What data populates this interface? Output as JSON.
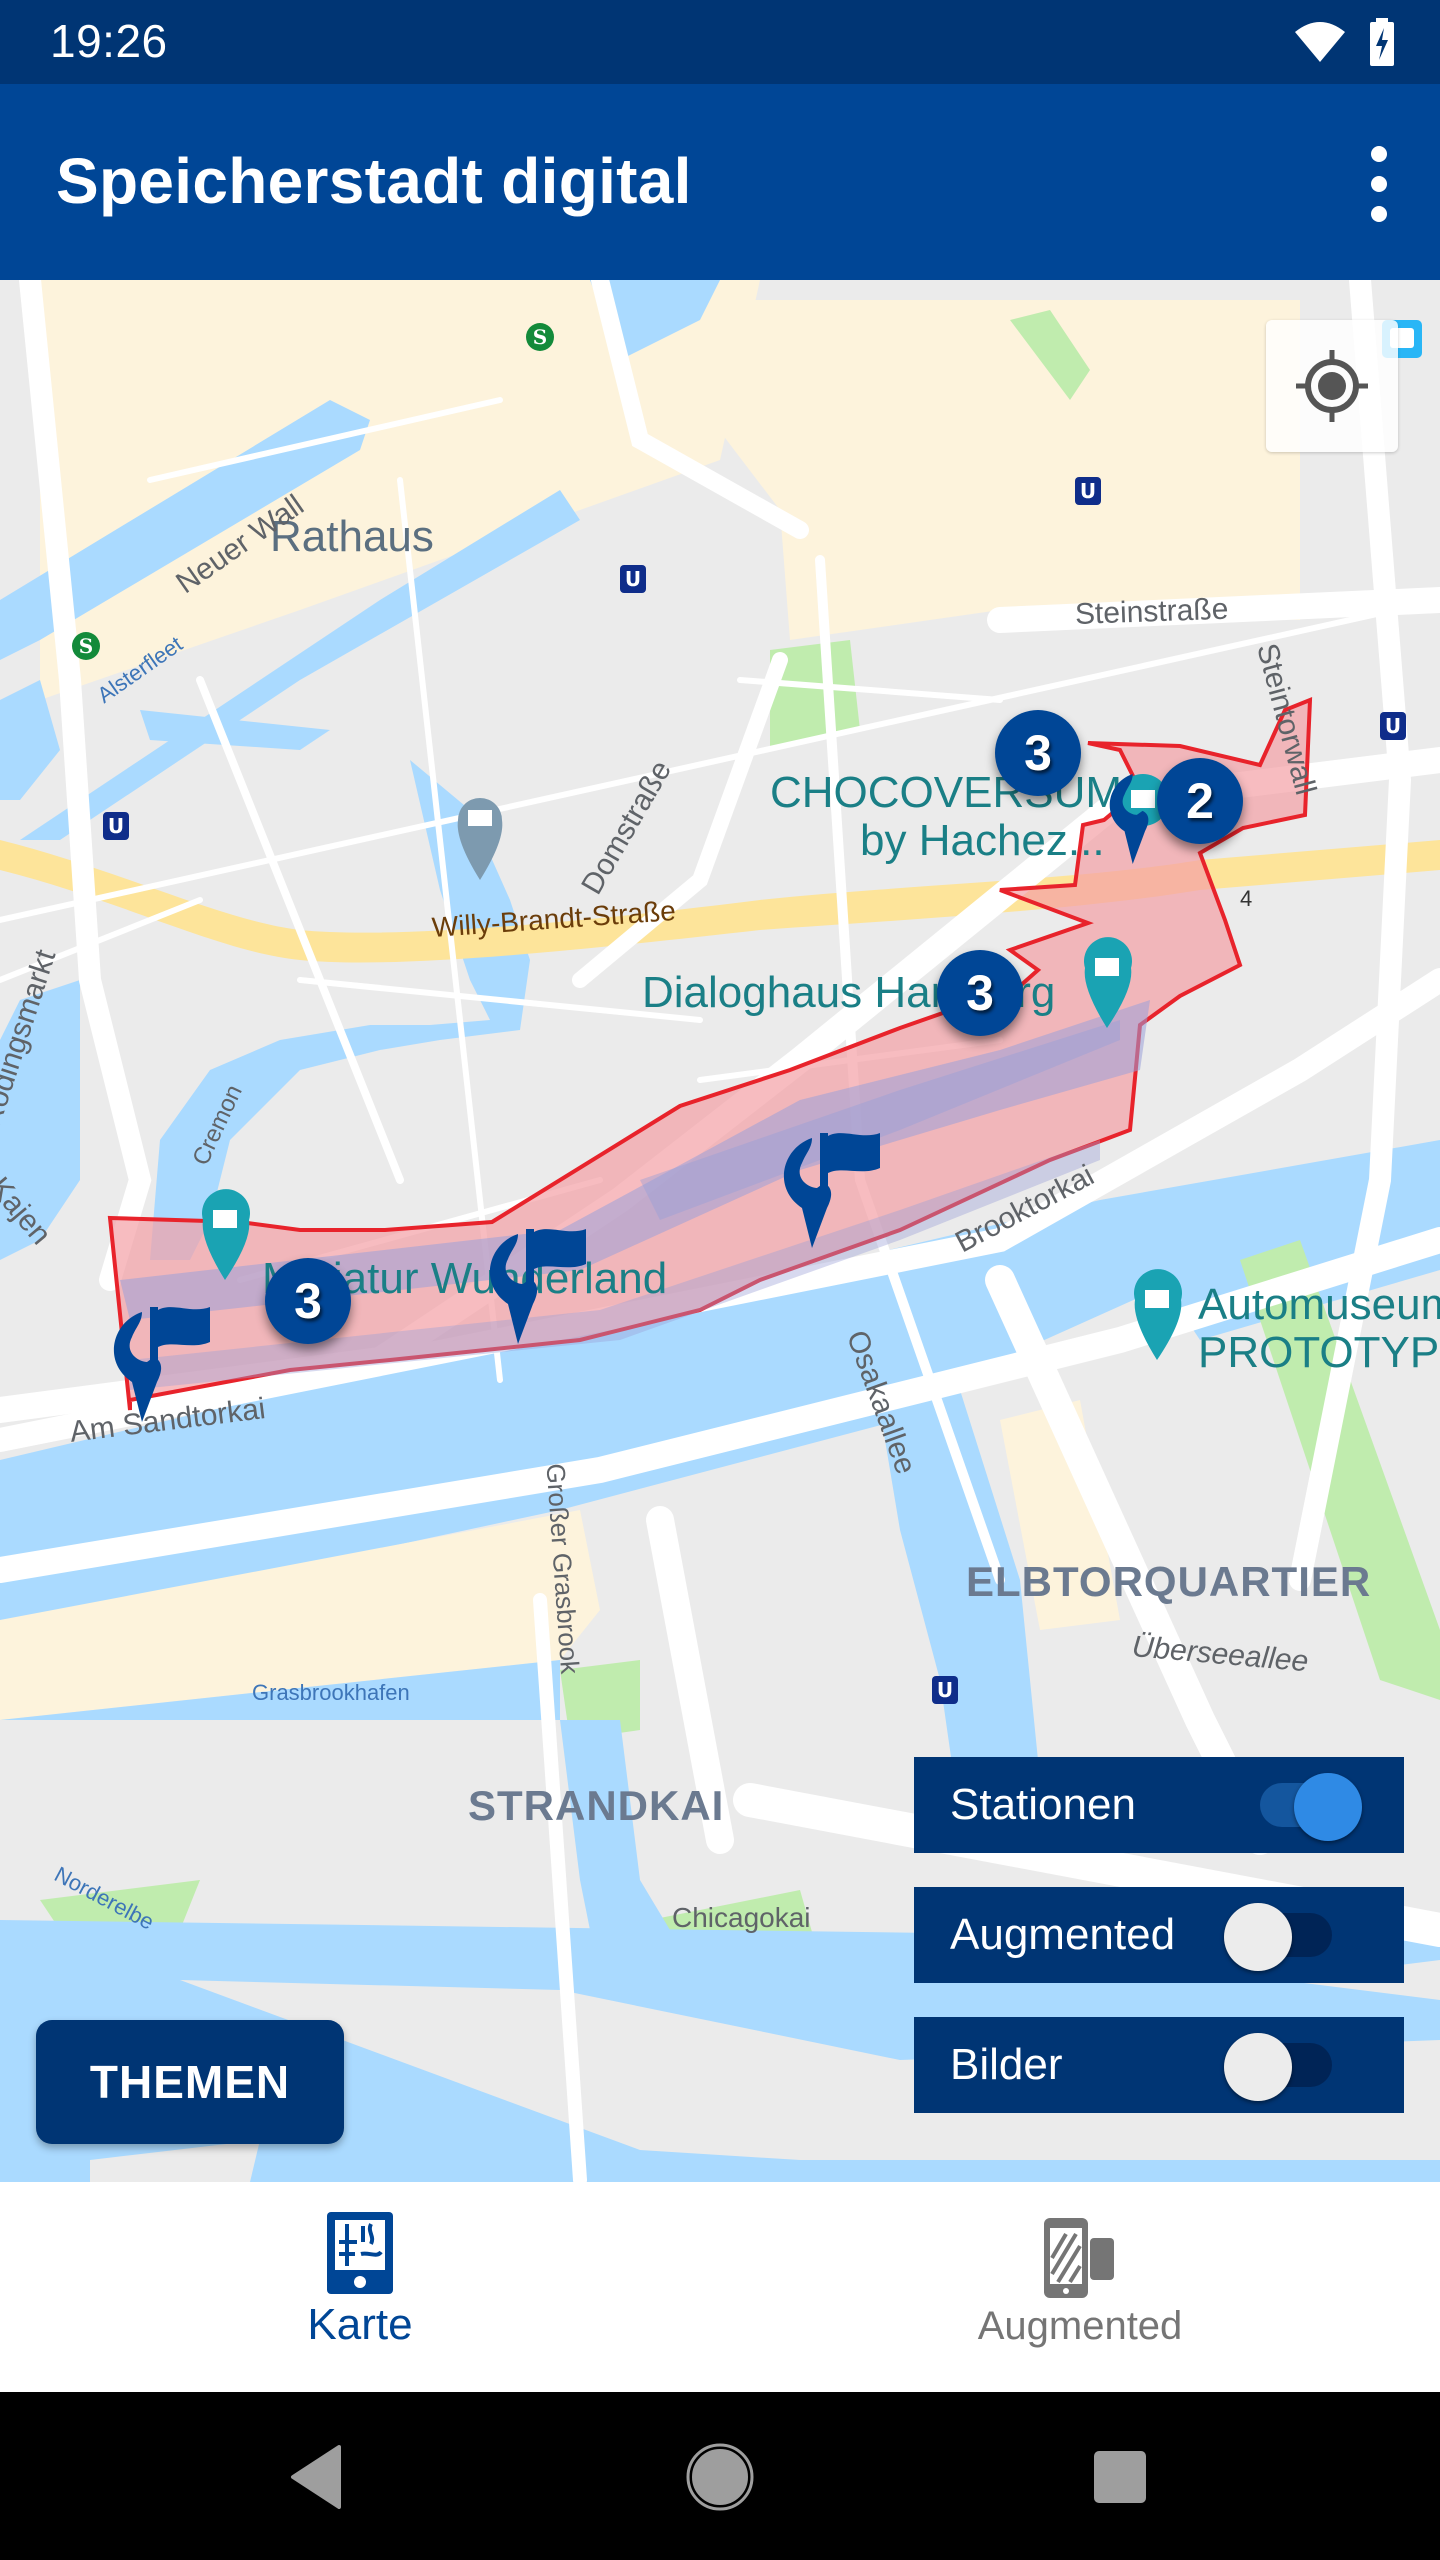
{
  "status_bar": {
    "time": "19:26",
    "icons": [
      "wifi-icon",
      "battery-charging-icon"
    ]
  },
  "app_bar": {
    "title": "Speicherstadt digital",
    "overflow_icon": "more-vert-icon"
  },
  "map": {
    "labels": {
      "rathaus": "Rathaus",
      "neuer_wall": "Neuer Wall",
      "alsterfleet": "Alsterfleet",
      "steinstrasse": "Steinstraße",
      "steintorwall": "Steintorwall",
      "domstrasse": "Domstraße",
      "willy_brandt": "Willy-Brandt-Straße",
      "roedingsmarkt": "Rödingsmarkt",
      "kajen": "Kajen",
      "cremon": "Cremon",
      "chocoversum_1": "CHOCOVERSUM",
      "chocoversum_2": "by Hachez...",
      "dialoghaus": "Dialoghaus Hamburg",
      "miniatur": "Miniatur Wunderland",
      "brooktorkai": "Brooktorkai",
      "am_sandtorkai": "Am Sandtorkai",
      "osakaallee": "Osakaallee",
      "automuseum_1": "Automuseum",
      "automuseum_2": "PROTOTYP",
      "elbtorquartier": "ELBTORQUARTIER",
      "ueberseeallee": "Überseeallee",
      "grosser_grasbrook": "Großer Grasbrook",
      "grasbrookhafen": "Grasbrookhafen",
      "strandkai": "STRANDKAI",
      "norderelbe": "Norderelbe",
      "chicagokai": "Chicagokai",
      "route_4": "4"
    },
    "clusters": [
      {
        "count": "3",
        "area": "chocoversum"
      },
      {
        "count": "2",
        "area": "chocoversum-east"
      },
      {
        "count": "3",
        "area": "dialoghaus"
      },
      {
        "count": "3",
        "area": "miniatur-wunderland"
      }
    ],
    "colors": {
      "polygon_stroke": "#e8232b",
      "polygon_fill": "#f5a5a8",
      "marker": "#004696",
      "poi": "#1aa3b3",
      "water": "#aadaff",
      "park": "#c0ecae",
      "built": "#fdf3dc"
    },
    "locate_icon": "my-location-icon"
  },
  "toggles": [
    {
      "label": "Stationen",
      "on": true
    },
    {
      "label": "Augmented",
      "on": false
    },
    {
      "label": "Bilder",
      "on": false
    }
  ],
  "themen_button": "THEMEN",
  "bottom_nav": [
    {
      "label": "Karte",
      "icon": "map-phone-icon",
      "active": true
    },
    {
      "label": "Augmented",
      "icon": "ar-phone-icon",
      "active": false
    }
  ],
  "system_nav": [
    "back-icon",
    "home-icon",
    "recents-icon"
  ]
}
